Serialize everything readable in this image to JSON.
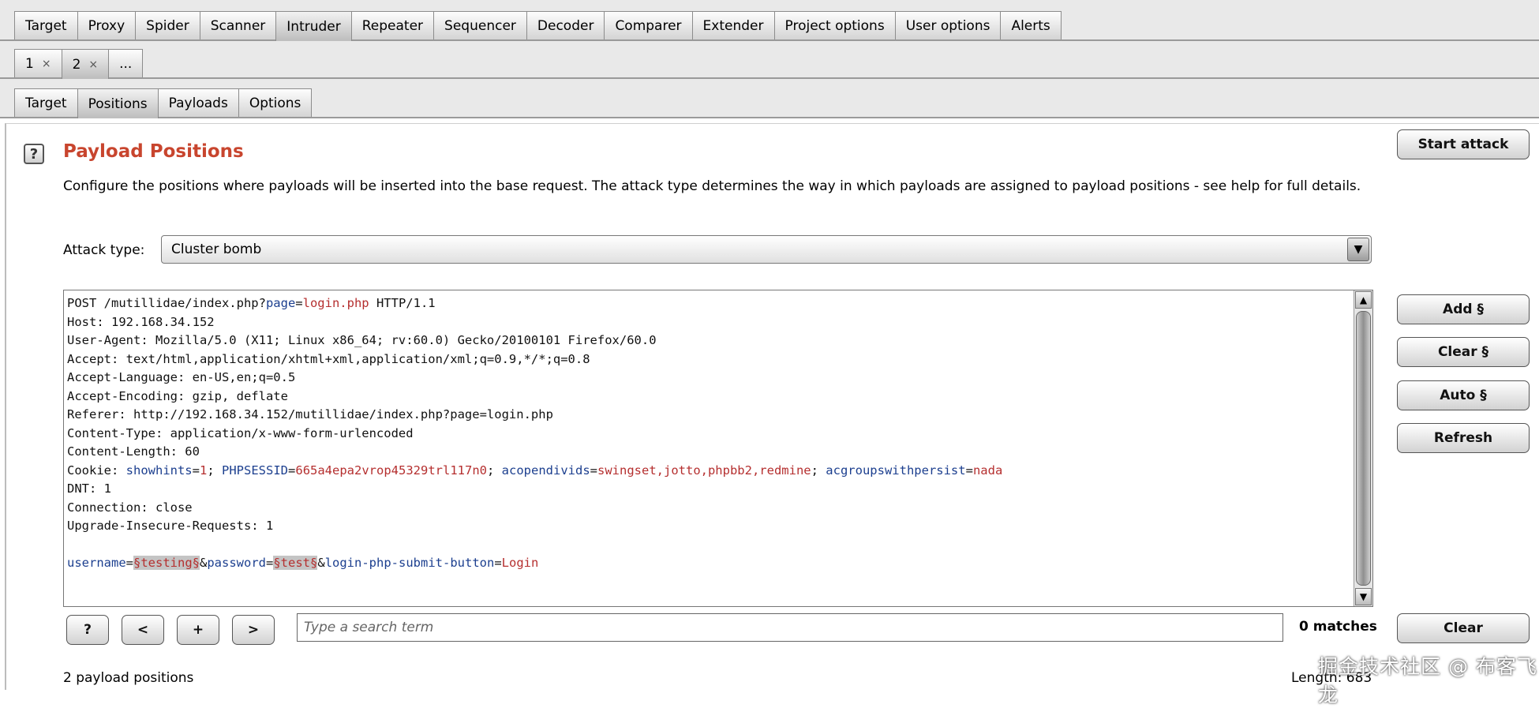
{
  "top_tabs": [
    "Target",
    "Proxy",
    "Spider",
    "Scanner",
    "Intruder",
    "Repeater",
    "Sequencer",
    "Decoder",
    "Comparer",
    "Extender",
    "Project options",
    "User options",
    "Alerts"
  ],
  "number_tabs": [
    {
      "label": "1",
      "close": "×"
    },
    {
      "label": "2",
      "close": "×"
    },
    {
      "label": "..."
    }
  ],
  "sub_tabs": [
    "Target",
    "Positions",
    "Payloads",
    "Options"
  ],
  "panel": {
    "help_glyph": "?",
    "title": "Payload Positions",
    "description": "Configure the positions where payloads will be inserted into the base request. The attack type determines the way in which payloads are assigned to payload positions - see help for full details.",
    "start_attack": "Start attack",
    "attack_type_label": "Attack type:",
    "attack_type_value": "Cluster bomb"
  },
  "request": {
    "line1": {
      "a": "POST /mutillidae/index.php?",
      "k": "page",
      "eq": "=",
      "v": "login.php",
      "b": " HTTP/1.1"
    },
    "headers": [
      "Host: 192.168.34.152",
      "User-Agent: Mozilla/5.0 (X11; Linux x86_64; rv:60.0) Gecko/20100101 Firefox/60.0",
      "Accept: text/html,application/xhtml+xml,application/xml;q=0.9,*/*;q=0.8",
      "Accept-Language: en-US,en;q=0.5",
      "Accept-Encoding: gzip, deflate",
      "Referer: http://192.168.34.152/mutillidae/index.php?page=login.php",
      "Content-Type: application/x-www-form-urlencoded",
      "Content-Length: 60"
    ],
    "cookie": {
      "name": "Cookie: ",
      "c1k": "showhints",
      "c1v": "1",
      "c2k": "PHPSESSID",
      "c2v": "665a4epa2vrop45329trl117n0",
      "c3k": "acopendivids",
      "c3v": "swingset,jotto,phpbb2,redmine",
      "c4k": "acgroupswithpersist",
      "c4v": "nada"
    },
    "headers2": [
      "DNT: 1",
      "Connection: close",
      "Upgrade-Insecure-Requests: 1"
    ],
    "body": {
      "k1": "username",
      "m1": "§testing§",
      "amp1": "&",
      "k2": "password",
      "m2": "§test§",
      "amp2": "&",
      "k3": "login-php-submit-button",
      "v3": "Login"
    }
  },
  "side_buttons": {
    "add": "Add §",
    "clear": "Clear §",
    "auto": "Auto §",
    "refresh": "Refresh"
  },
  "search": {
    "help": "?",
    "prev": "<",
    "add": "+",
    "next": ">",
    "placeholder": "Type a search term",
    "matches": "0 matches",
    "clear": "Clear"
  },
  "status": {
    "left": "2 payload positions",
    "right": "Length: 683"
  },
  "watermark": "掘金技术社区 @ 布客飞龙"
}
